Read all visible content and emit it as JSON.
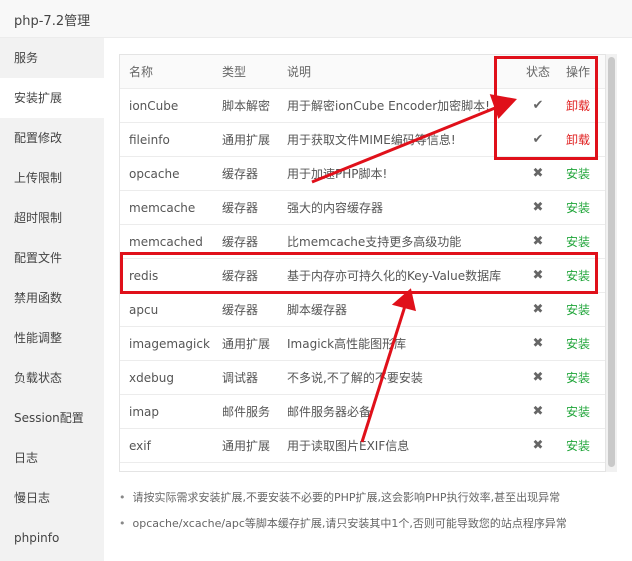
{
  "window": {
    "title": "php-7.2管理"
  },
  "sidebar": {
    "items": [
      {
        "label": "服务"
      },
      {
        "label": "安装扩展",
        "active": true
      },
      {
        "label": "配置修改"
      },
      {
        "label": "上传限制"
      },
      {
        "label": "超时限制"
      },
      {
        "label": "配置文件"
      },
      {
        "label": "禁用函数"
      },
      {
        "label": "性能调整"
      },
      {
        "label": "负载状态"
      },
      {
        "label": "Session配置"
      },
      {
        "label": "日志"
      },
      {
        "label": "慢日志"
      },
      {
        "label": "phpinfo"
      }
    ]
  },
  "table": {
    "headers": {
      "name": "名称",
      "type": "类型",
      "desc": "说明",
      "status": "状态",
      "op": "操作"
    },
    "rows": [
      {
        "name": "ionCube",
        "type": "脚本解密",
        "desc": "用于解密ionCube Encoder加密脚本!",
        "status": "✔",
        "op": "卸载",
        "installed": true
      },
      {
        "name": "fileinfo",
        "type": "通用扩展",
        "desc": "用于获取文件MIME编码等信息!",
        "status": "✔",
        "op": "卸载",
        "installed": true
      },
      {
        "name": "opcache",
        "type": "缓存器",
        "desc": "用于加速PHP脚本!",
        "status": "✖",
        "op": "安装",
        "installed": false
      },
      {
        "name": "memcache",
        "type": "缓存器",
        "desc": "强大的内容缓存器",
        "status": "✖",
        "op": "安装",
        "installed": false
      },
      {
        "name": "memcached",
        "type": "缓存器",
        "desc": "比memcache支持更多高级功能",
        "status": "✖",
        "op": "安装",
        "installed": false
      },
      {
        "name": "redis",
        "type": "缓存器",
        "desc": "基于内存亦可持久化的Key-Value数据库",
        "status": "✖",
        "op": "安装",
        "installed": false
      },
      {
        "name": "apcu",
        "type": "缓存器",
        "desc": "脚本缓存器",
        "status": "✖",
        "op": "安装",
        "installed": false
      },
      {
        "name": "imagemagick",
        "type": "通用扩展",
        "desc": "Imagick高性能图形库",
        "status": "✖",
        "op": "安装",
        "installed": false
      },
      {
        "name": "xdebug",
        "type": "调试器",
        "desc": "不多说,不了解的不要安装",
        "status": "✖",
        "op": "安装",
        "installed": false
      },
      {
        "name": "imap",
        "type": "邮件服务",
        "desc": "邮件服务器必备",
        "status": "✖",
        "op": "安装",
        "installed": false
      },
      {
        "name": "exif",
        "type": "通用扩展",
        "desc": "用于读取图片EXIF信息",
        "status": "✖",
        "op": "安装",
        "installed": false
      }
    ]
  },
  "notes": [
    "请按实际需求安装扩展,不要安装不必要的PHP扩展,这会影响PHP执行效率,甚至出现异常",
    "opcache/xcache/apc等脚本缓存扩展,请只安装其中1个,否则可能导致您的站点程序异常"
  ],
  "colors": {
    "install": "#20a53a",
    "uninstall": "#e02020",
    "annotation": "#e0101a"
  },
  "icons": {
    "installed": "check-icon",
    "not_installed": "cross-icon"
  }
}
